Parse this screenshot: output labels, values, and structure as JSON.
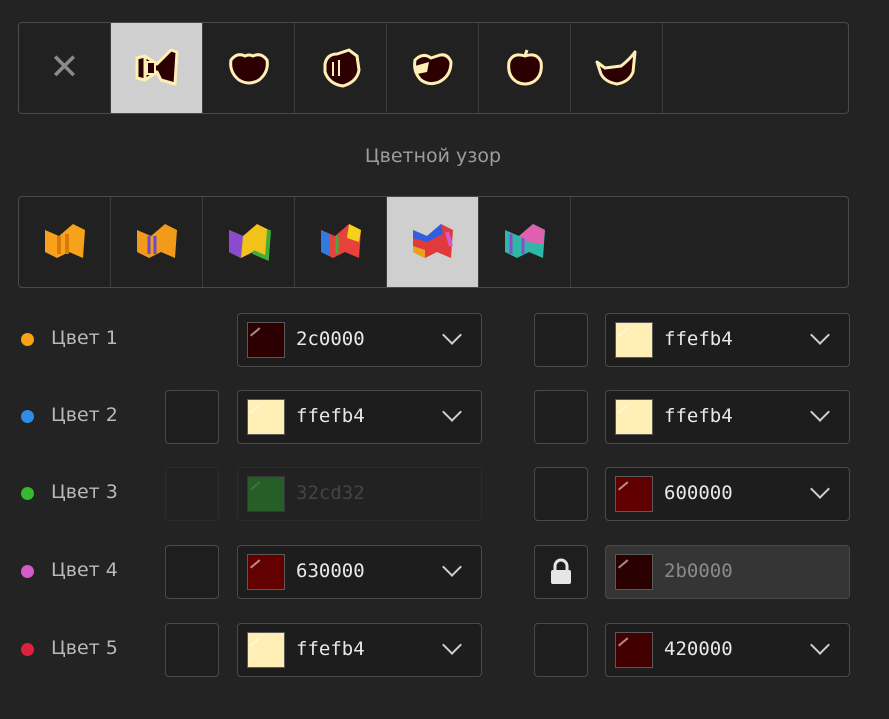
{
  "shape_tiles": [
    {
      "icon": "close-icon",
      "glyph": "✕"
    },
    {
      "icon": "bow-tie-shape-icon"
    },
    {
      "icon": "heart-round-shape-icon"
    },
    {
      "icon": "heart-knot-shape-icon"
    },
    {
      "icon": "heart-split-shape-icon"
    },
    {
      "icon": "apple-shape-icon"
    },
    {
      "icon": "cup-shape-icon"
    }
  ],
  "section_title": "Цветной узор",
  "pattern_tiles": [
    {
      "icon": "pattern-orange-icon",
      "colors": [
        "#f7a21b",
        "#d97a0a",
        "#ffd36b"
      ]
    },
    {
      "icon": "pattern-orange-stripes-icon",
      "colors": [
        "#f29a1a",
        "#6b4cc7",
        "#ffd36b"
      ]
    },
    {
      "icon": "pattern-purple-yellow-icon",
      "colors": [
        "#8a4bd1",
        "#f2c21b",
        "#3fae3a"
      ]
    },
    {
      "icon": "pattern-rainbow-icon",
      "colors": [
        "#2f7be0",
        "#e8403a",
        "#f2d21b"
      ]
    },
    {
      "icon": "pattern-red-blue-icon",
      "colors": [
        "#e03a3a",
        "#2f5fe0",
        "#e8a21b"
      ]
    },
    {
      "icon": "pattern-teal-pink-icon",
      "colors": [
        "#2fb8a8",
        "#e060b0",
        "#8a4bd1"
      ]
    }
  ],
  "rows": [
    {
      "label": "Цвет 1",
      "dot": "#f6a414",
      "left": {
        "hex": "2c0000",
        "color": "#2c0000",
        "square": false,
        "disabled": false
      },
      "right": {
        "hex": "ffefb4",
        "color": "#ffefb4",
        "locked": false
      }
    },
    {
      "label": "Цвет 2",
      "dot": "#2d8de8",
      "left": {
        "hex": "ffefb4",
        "color": "#ffefb4",
        "square": true,
        "disabled": false
      },
      "right": {
        "hex": "ffefb4",
        "color": "#ffefb4",
        "locked": false
      }
    },
    {
      "label": "Цвет 3",
      "dot": "#36b82f",
      "left": {
        "hex": "32cd32",
        "color": "#32cd32",
        "square": true,
        "disabled": true
      },
      "right": {
        "hex": "600000",
        "color": "#600000",
        "locked": false
      }
    },
    {
      "label": "Цвет 4",
      "dot": "#d45cc8",
      "left": {
        "hex": "630000",
        "color": "#630000",
        "square": true,
        "disabled": false
      },
      "right": {
        "hex": "2b0000",
        "color": "#2b0000",
        "locked": true
      }
    },
    {
      "label": "Цвет 5",
      "dot": "#e0203f",
      "left": {
        "hex": "ffefb4",
        "color": "#ffefb4",
        "square": true,
        "disabled": false
      },
      "right": {
        "hex": "420000",
        "color": "#420000",
        "locked": false
      }
    }
  ]
}
